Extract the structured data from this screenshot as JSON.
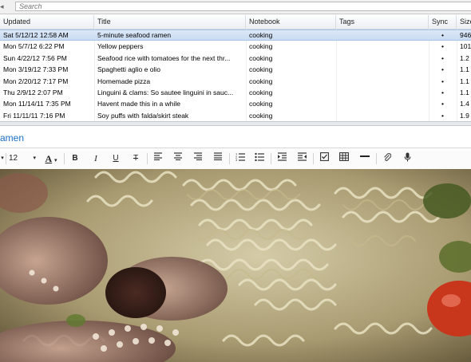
{
  "search": {
    "placeholder": "Search"
  },
  "columns": {
    "updated": "Updated",
    "title": "Title",
    "notebook": "Notebook",
    "tags": "Tags",
    "sync": "Sync",
    "size": "Size"
  },
  "notes": [
    {
      "updated": "Sat 5/12/12 12:58 AM",
      "title": "5-minute seafood ramen",
      "notebook": "cooking",
      "tags": "",
      "sync": "•",
      "size": "946"
    },
    {
      "updated": "Mon 5/7/12 6:22 PM",
      "title": "Yellow peppers",
      "notebook": "cooking",
      "tags": "",
      "sync": "•",
      "size": "101"
    },
    {
      "updated": "Sun 4/22/12 7:56 PM",
      "title": "Seafood rice with tomatoes for the next thr...",
      "notebook": "cooking",
      "tags": "",
      "sync": "•",
      "size": "1.2"
    },
    {
      "updated": "Mon 3/19/12 7:33 PM",
      "title": "Spaghetti aglio e olio",
      "notebook": "cooking",
      "tags": "",
      "sync": "•",
      "size": "1.1"
    },
    {
      "updated": "Mon 2/20/12 7:17 PM",
      "title": "Homemade pizza",
      "notebook": "cooking",
      "tags": "",
      "sync": "•",
      "size": "1.1"
    },
    {
      "updated": "Thu 2/9/12 2:07 PM",
      "title": "Linguini & clams: So sautee linguini in sauc...",
      "notebook": "cooking",
      "tags": "",
      "sync": "•",
      "size": "1.1"
    },
    {
      "updated": "Mon 11/14/11 7:35 PM",
      "title": "Havent made this in a while",
      "notebook": "cooking",
      "tags": "",
      "sync": "•",
      "size": "1.4"
    },
    {
      "updated": "Fri 11/11/11 7:16 PM",
      "title": "Soy puffs with falda/skirt steak",
      "notebook": "cooking",
      "tags": "",
      "sync": "•",
      "size": "1.9"
    }
  ],
  "note": {
    "title_visible": "amen"
  },
  "toolbar": {
    "font_size": "12",
    "font_color_label": "A",
    "bold": "B",
    "italic": "I",
    "underline": "U",
    "strikethrough": "T"
  },
  "colors": {
    "accent": "#1b6fc4",
    "selection": "#c9dcf2"
  },
  "icons": [
    "dropdown-arrow-icon",
    "font-color-icon",
    "bold-icon",
    "italic-icon",
    "underline-icon",
    "strikethrough-icon",
    "align-left-icon",
    "align-center-icon",
    "align-right-icon",
    "justify-icon",
    "numbered-list-icon",
    "bulleted-list-icon",
    "indent-icon",
    "outdent-icon",
    "checkbox-icon",
    "table-icon",
    "horizontal-rule-icon",
    "attachment-icon",
    "microphone-icon"
  ]
}
